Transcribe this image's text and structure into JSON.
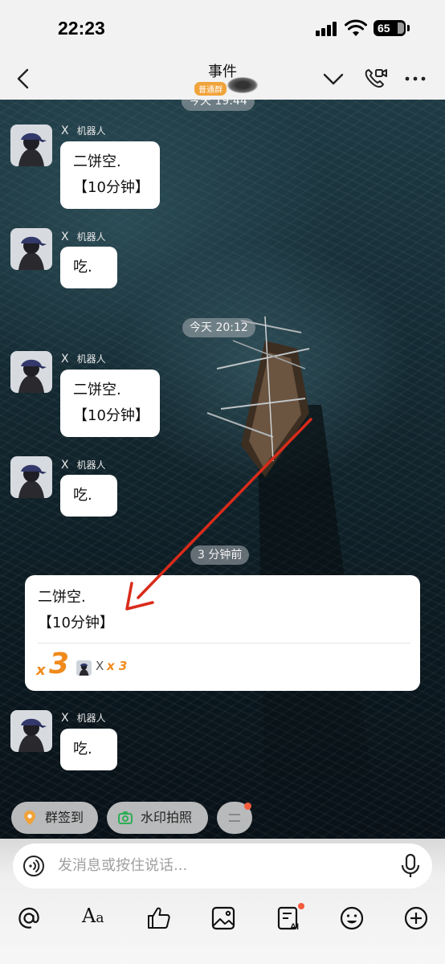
{
  "status_bar": {
    "time": "22:23",
    "battery": "65"
  },
  "nav": {
    "title": "事件",
    "badge": "普通群"
  },
  "timestamps": {
    "top_partial": "今天 19:44",
    "middle": "今天 20:12",
    "recent": "3 分钟前"
  },
  "messages": [
    {
      "sender_x": "X",
      "sender_role": "机器人",
      "text": "二饼空.\n【10分钟】"
    },
    {
      "sender_x": "X",
      "sender_role": "机器人",
      "text": "吃."
    },
    {
      "sender_x": "X",
      "sender_role": "机器人",
      "text": "二饼空.\n【10分钟】"
    },
    {
      "sender_x": "X",
      "sender_role": "机器人",
      "text": "吃."
    },
    {
      "sender_x": "X",
      "sender_role": "机器人",
      "text": "吃."
    }
  ],
  "highlight_card": {
    "text": "二饼空.\n【10分钟】",
    "count_prefix": "x",
    "count": "3",
    "mini_label": "X",
    "mini_count": "x 3"
  },
  "chips": {
    "checkin": "群签到",
    "watermark": "水印拍照"
  },
  "input": {
    "placeholder": "发消息或按住说话..."
  },
  "colors": {
    "accent_orange": "#f08a1c",
    "badge": "#f0a33a",
    "arrow": "#d92b1a",
    "notify_dot": "#f55a3c"
  },
  "icons": [
    "back-icon",
    "chevron-down-icon",
    "video-call-icon",
    "more-icon",
    "voice-icon",
    "mic-icon",
    "at-icon",
    "font-icon",
    "thumbs-up-icon",
    "image-icon",
    "ai-note-icon",
    "emoji-icon",
    "plus-icon"
  ]
}
